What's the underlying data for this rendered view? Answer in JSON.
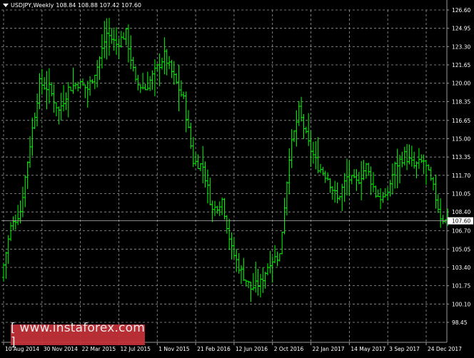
{
  "header": {
    "symbol": "USDJPY,Weekly",
    "ohlc": "108.84 108.88 107.42 107.60"
  },
  "watermark": {
    "text": "[ www.instaforex.com ]"
  },
  "current_price_label": "107.60",
  "colors": {
    "background": "#000000",
    "candle": "#00ff00",
    "grid": "#9a9a9a",
    "axis_text": "#ffffff",
    "watermark_bg": "#c8323a"
  },
  "chart_data": {
    "type": "line",
    "style": "ohlc-bars",
    "symbol": "USDJPY",
    "timeframe": "Weekly",
    "current_price": 107.6,
    "ylim": [
      98.45,
      126.6
    ],
    "y_ticks": [
      126.6,
      124.95,
      123.3,
      121.65,
      120.0,
      118.35,
      116.65,
      115.0,
      113.35,
      111.7,
      110.05,
      108.4,
      106.7,
      105.05,
      103.4,
      101.75,
      100.1,
      98.45
    ],
    "x_tick_labels": [
      "10 Aug 2014",
      "30 Nov 2014",
      "22 Mar 2015",
      "12 Jul 2015",
      "1 Nov 2015",
      "21 Feb 2016",
      "12 Jun 2016",
      "2 Oct 2016",
      "22 Jan 2017",
      "14 May 2017",
      "3 Sep 2017",
      "24 Dec 2017"
    ],
    "grid": true,
    "price_path": [
      {
        "x": "10 Aug 2014",
        "y": 102.5
      },
      {
        "x": "7 Sep 2014",
        "y": 107.0
      },
      {
        "x": "5 Oct 2014",
        "y": 108.5
      },
      {
        "x": "2 Nov 2014",
        "y": 114.5
      },
      {
        "x": "30 Nov 2014",
        "y": 120.0
      },
      {
        "x": "28 Dec 2014",
        "y": 119.5
      },
      {
        "x": "25 Jan 2015",
        "y": 117.5
      },
      {
        "x": "22 Feb 2015",
        "y": 119.5
      },
      {
        "x": "22 Mar 2015",
        "y": 120.0
      },
      {
        "x": "19 Apr 2015",
        "y": 119.5
      },
      {
        "x": "17 May 2015",
        "y": 121.5
      },
      {
        "x": "14 Jun 2015",
        "y": 124.5
      },
      {
        "x": "12 Jul 2015",
        "y": 123.5
      },
      {
        "x": "9 Aug 2015",
        "y": 124.5
      },
      {
        "x": "6 Sep 2015",
        "y": 120.0
      },
      {
        "x": "4 Oct 2015",
        "y": 119.5
      },
      {
        "x": "1 Nov 2015",
        "y": 121.0
      },
      {
        "x": "29 Nov 2015",
        "y": 122.5
      },
      {
        "x": "27 Dec 2015",
        "y": 120.5
      },
      {
        "x": "24 Jan 2016",
        "y": 118.5
      },
      {
        "x": "21 Feb 2016",
        "y": 113.0
      },
      {
        "x": "20 Mar 2016",
        "y": 112.5
      },
      {
        "x": "17 Apr 2016",
        "y": 108.5
      },
      {
        "x": "15 May 2016",
        "y": 109.5
      },
      {
        "x": "12 Jun 2016",
        "y": 105.0
      },
      {
        "x": "10 Jul 2016",
        "y": 103.0
      },
      {
        "x": "7 Aug 2016",
        "y": 101.5
      },
      {
        "x": "4 Sep 2016",
        "y": 102.0
      },
      {
        "x": "2 Oct 2016",
        "y": 104.0
      },
      {
        "x": "30 Oct 2016",
        "y": 104.5
      },
      {
        "x": "27 Nov 2016",
        "y": 113.5
      },
      {
        "x": "25 Dec 2016",
        "y": 117.5
      },
      {
        "x": "22 Jan 2017",
        "y": 114.5
      },
      {
        "x": "19 Feb 2017",
        "y": 112.5
      },
      {
        "x": "19 Mar 2017",
        "y": 111.5
      },
      {
        "x": "16 Apr 2017",
        "y": 109.5
      },
      {
        "x": "14 May 2017",
        "y": 111.5
      },
      {
        "x": "11 Jun 2017",
        "y": 111.0
      },
      {
        "x": "9 Jul 2017",
        "y": 112.5
      },
      {
        "x": "6 Aug 2017",
        "y": 110.0
      },
      {
        "x": "3 Sep 2017",
        "y": 109.5
      },
      {
        "x": "1 Oct 2017",
        "y": 112.5
      },
      {
        "x": "29 Oct 2017",
        "y": 113.5
      },
      {
        "x": "26 Nov 2017",
        "y": 112.5
      },
      {
        "x": "24 Dec 2017",
        "y": 113.0
      },
      {
        "x": "21 Jan 2018",
        "y": 110.5
      },
      {
        "x": "11 Feb 2018",
        "y": 108.0
      },
      {
        "x": "25 Feb 2018",
        "y": 107.6
      }
    ]
  }
}
